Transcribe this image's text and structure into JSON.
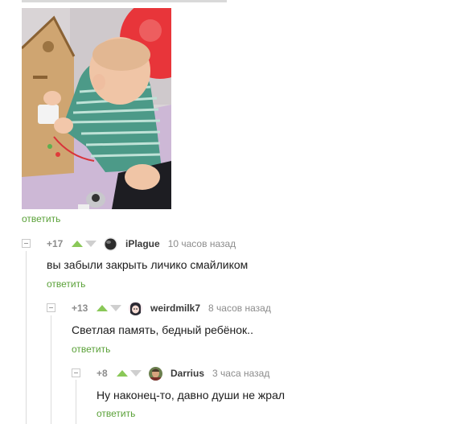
{
  "post": {
    "reply_label": "ответить",
    "image_alt": "baby-playing-with-busy-board-house"
  },
  "comments": [
    {
      "rating": "+17",
      "username": "iPlague",
      "time": "10 часов назад",
      "text": "вы забыли закрыть личико смайликом",
      "reply_label": "ответить",
      "avatar_icon": "avatar-dark-circle"
    },
    {
      "rating": "+13",
      "username": "weirdmilk7",
      "time": "8 часов назад",
      "text": "Светлая память, бедный ребёнок..",
      "reply_label": "ответить",
      "avatar_icon": "avatar-anime-girl"
    },
    {
      "rating": "+8",
      "username": "Darrius",
      "time": "3 часа назад",
      "text": "Ну наконец-то, давно души не жрал",
      "reply_label": "ответить",
      "avatar_icon": "avatar-photo-man"
    }
  ],
  "colors": {
    "link_green": "#5aa138",
    "upvote_green": "#8ac858",
    "downvote_gray": "#cfcfcf",
    "meta_gray": "#8c8c8c"
  }
}
